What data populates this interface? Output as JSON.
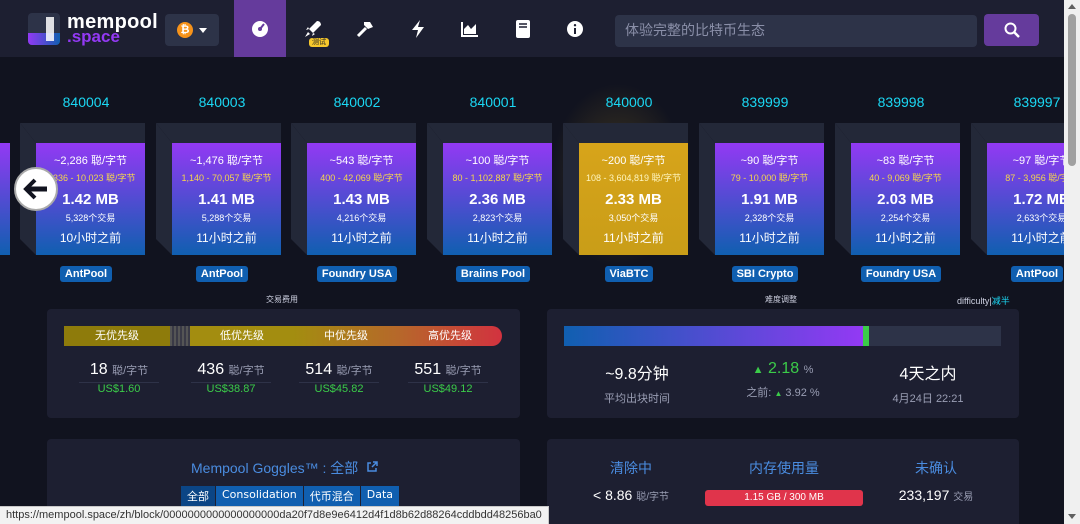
{
  "nav": {
    "brand_line1": "mempool",
    "brand_line2": ".space",
    "beta_badge": "测试",
    "search_placeholder": "体验完整的比特币生态",
    "network_icon": "bitcoin-icon"
  },
  "blocks": [
    {
      "height": "840004",
      "fee": "~2,286 聪/字节",
      "range": "1,336 - 10,023 聪/字节",
      "size": "1.42 MB",
      "tx": "5,328个交易",
      "time": "10小时之前",
      "pool": "AntPool"
    },
    {
      "height": "840003",
      "fee": "~1,476 聪/字节",
      "range": "1,140 - 70,057 聪/字节",
      "size": "1.41 MB",
      "tx": "5,288个交易",
      "time": "11小时之前",
      "pool": "AntPool"
    },
    {
      "height": "840002",
      "fee": "~543 聪/字节",
      "range": "400 - 42,069 聪/字节",
      "size": "1.43 MB",
      "tx": "4,216个交易",
      "time": "11小时之前",
      "pool": "Foundry USA"
    },
    {
      "height": "840001",
      "fee": "~100 聪/字节",
      "range": "80 - 1,102,887 聪/字节",
      "size": "2.36 MB",
      "tx": "2,823个交易",
      "time": "11小时之前",
      "pool": "Braiins Pool"
    },
    {
      "height": "840000",
      "fee": "~200 聪/字节",
      "range": "108 - 3,604,819 聪/字节",
      "size": "2.33 MB",
      "tx": "3,050个交易",
      "time": "11小时之前",
      "pool": "ViaBTC"
    },
    {
      "height": "839999",
      "fee": "~90 聪/字节",
      "range": "79 - 10,000 聪/字节",
      "size": "1.91 MB",
      "tx": "2,328个交易",
      "time": "11小时之前",
      "pool": "SBI Crypto"
    },
    {
      "height": "839998",
      "fee": "~83 聪/字节",
      "range": "40 - 9,069 聪/字节",
      "size": "2.03 MB",
      "tx": "2,254个交易",
      "time": "11小时之前",
      "pool": "Foundry USA"
    },
    {
      "height": "839997",
      "fee": "~97 聪/字节",
      "range": "87 - 3,956 聪/字节",
      "size": "1.72 MB",
      "tx": "2,633个交易",
      "time": "11小时之前",
      "pool": "AntPool"
    }
  ],
  "fees": {
    "section_label": "交易费用",
    "priority_labels": [
      "无优先级",
      "低优先级",
      "中优先级",
      "高优先级"
    ],
    "values": [
      {
        "rate": "18",
        "unit": "聪/字节",
        "usd": "US$1.60"
      },
      {
        "rate": "436",
        "unit": "聪/字节",
        "usd": "US$38.87"
      },
      {
        "rate": "514",
        "unit": "聪/字节",
        "usd": "US$45.82"
      },
      {
        "rate": "551",
        "unit": "聪/字节",
        "usd": "US$49.12"
      }
    ]
  },
  "difficulty": {
    "section_label": "难度调整",
    "link_label": "difficulty",
    "link_sep": "|",
    "link_alt": "减半",
    "progress": 0.685,
    "avg_time": "~9.8分钟",
    "avg_time_label": "平均出块时间",
    "change": "2.18",
    "change_unit": "%",
    "prev_label": "之前:",
    "prev_change": "3.92 %",
    "eta": "4天之内",
    "eta_date": "4月24日 22:21"
  },
  "goggles": {
    "title": "Mempool Goggles™ : 全部",
    "tabs": [
      "全部",
      "Consolidation",
      "代币混合",
      "Data"
    ]
  },
  "mempool": {
    "purge_label": "清除中",
    "purge_value": "< 8.86",
    "purge_unit": "聪/字节",
    "memory_label": "内存使用量",
    "memory_value": "1.15 GB / 300 MB",
    "unconfirmed_label": "未确认",
    "unconfirmed_value": "233,197",
    "unconfirmed_unit": "交易"
  },
  "status_url": "https://mempool.space/zh/block/0000000000000000000da20f7d8e9e6412d4f1d8b62d88264cddbdd48256ba0"
}
